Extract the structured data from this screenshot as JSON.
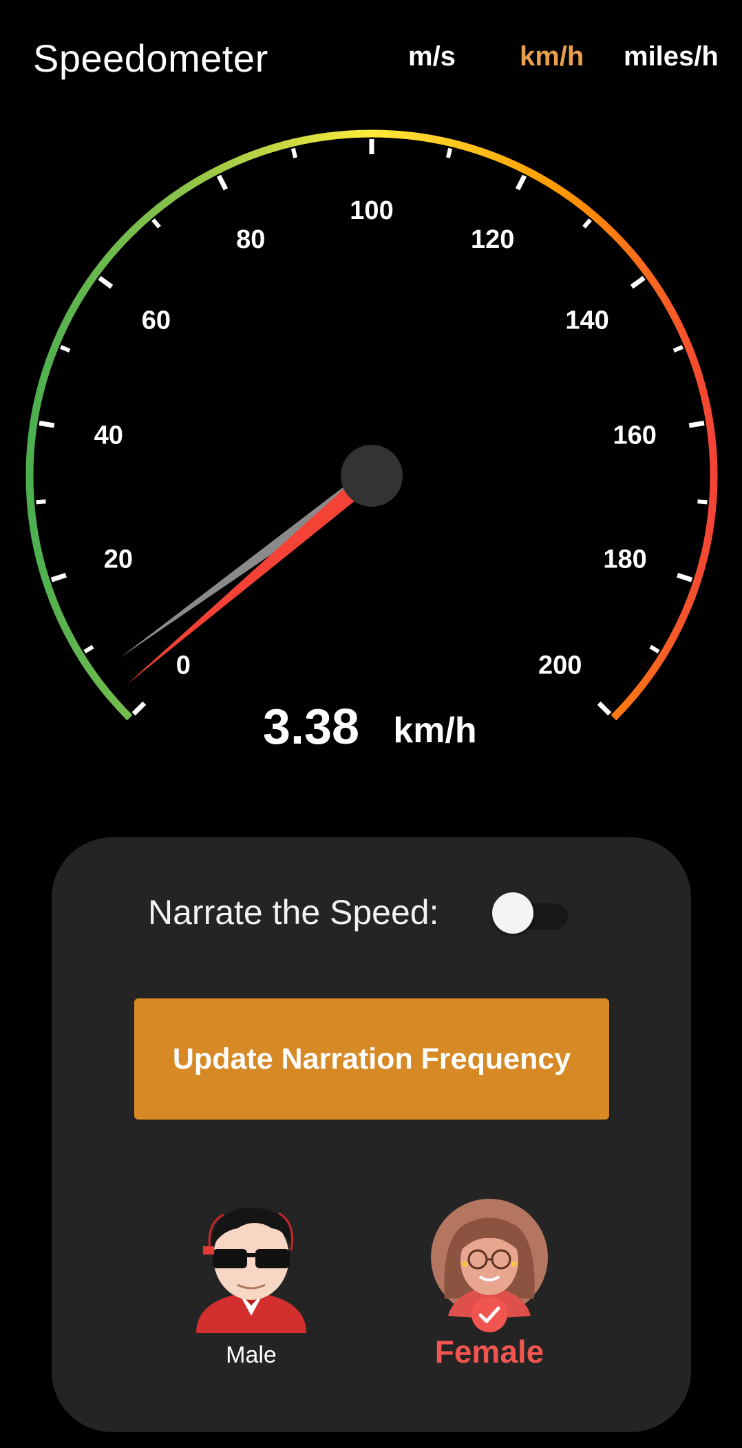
{
  "header": {
    "title": "Speedometer",
    "units": [
      {
        "label": "m/s",
        "selected": false
      },
      {
        "label": "km/h",
        "selected": true
      },
      {
        "label": "miles/h",
        "selected": false
      }
    ]
  },
  "gauge": {
    "min": 0,
    "max": 200,
    "tick_labels": [
      "0",
      "20",
      "40",
      "60",
      "80",
      "100",
      "120",
      "140",
      "160",
      "180",
      "200"
    ],
    "current_speed": 3.38,
    "speed_text": "3.38",
    "unit_text": "km/h",
    "arc_colors": [
      "#4caf50",
      "#8bc34a",
      "#ffeb3b",
      "#ff9800",
      "#f44336"
    ],
    "needle_color": "#f44336"
  },
  "narration": {
    "label": "Narrate the Speed:",
    "enabled": false,
    "update_button": "Update Narration Frequency"
  },
  "voices": {
    "male": {
      "label": "Male",
      "selected": false
    },
    "female": {
      "label": "Female",
      "selected": true
    }
  },
  "colors": {
    "accent": "#e8a04a",
    "button": "#d68924",
    "selected_voice": "#f05550",
    "card": "#242424"
  }
}
